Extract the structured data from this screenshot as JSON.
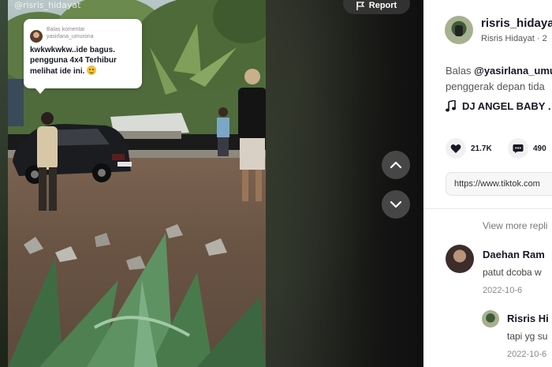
{
  "video": {
    "watermark": "@risris_hidayat",
    "report_label": "Report",
    "reply_bubble": {
      "label": "Balas komentar",
      "username": "yasirlana_umurona",
      "text": "kwkwkwkw..ide bagus. pengguna 4x4 Terhibur melihat ide ini."
    }
  },
  "navigation": {
    "up_icon": "chevron-up-icon",
    "down_icon": "chevron-down-icon"
  },
  "author": {
    "handle": "risris_hidaya",
    "name_date": "Risris Hidayat · 2"
  },
  "caption": {
    "prefix": "Balas ",
    "mention": "@yasirlana_umu",
    "line2": "penggerak depan tida"
  },
  "music": {
    "icon": "music-note-icon",
    "title": "DJ ANGEL BABY ."
  },
  "stats": {
    "likes": "21.7K",
    "comments": "490"
  },
  "share_url": "https://www.tiktok.com",
  "comments": {
    "view_more": "View more repli",
    "items": [
      {
        "name": "Daehan Ram",
        "text": "patut dcoba w",
        "date": "2022-10-6"
      },
      {
        "name": "Risris Hi",
        "text": "tapi yg su",
        "date": "2022-10-6"
      }
    ]
  },
  "colors": {
    "panel_bg": "#ffffff",
    "text_primary": "#161823",
    "text_secondary": "#555555",
    "nav_button_bg": "#545454"
  }
}
